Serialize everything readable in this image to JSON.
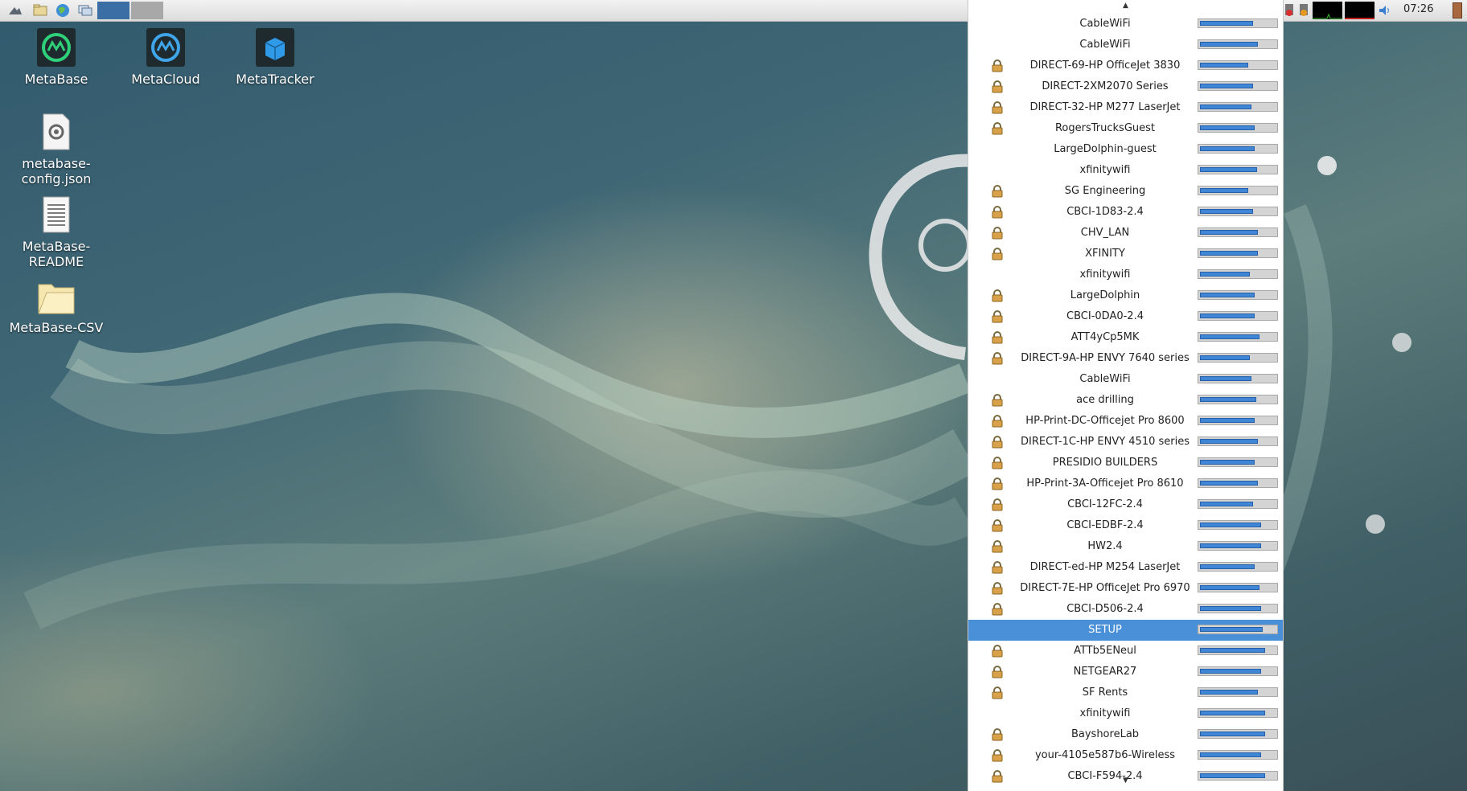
{
  "panel": {
    "clock": "07:26",
    "workspaces": [
      {
        "name": "workspace-1",
        "color": "#3b6ea5"
      },
      {
        "name": "workspace-2",
        "color": "#a8a8a8"
      }
    ],
    "launchers": [
      "menu-icon",
      "file-manager-icon",
      "web-browser-icon",
      "window-list-icon"
    ],
    "tray": [
      "network-error-icon",
      "network-warning-icon",
      "cpu-monitor-icon",
      "memory-monitor-icon",
      "volume-icon",
      "logout-icon"
    ]
  },
  "desktop": {
    "icons": [
      {
        "label": "MetaBase",
        "icon": "metabase-icon"
      },
      {
        "label": "MetaCloud",
        "icon": "metacloud-icon"
      },
      {
        "label": "MetaTracker",
        "icon": "metatracker-icon"
      },
      {
        "label": "metabase-config.json",
        "line1": "metabase-",
        "line2": "config.json",
        "icon": "config-file-icon"
      },
      {
        "label": "MetaBase-README",
        "line1": "MetaBase-",
        "line2": "README",
        "icon": "text-file-icon"
      },
      {
        "label": "MetaBase-CSV",
        "icon": "folder-icon"
      }
    ]
  },
  "wifi_menu": {
    "selected_ssid": "SETUP",
    "networks": [
      {
        "ssid": "CableWiFi",
        "secured": false,
        "signal": 0.7
      },
      {
        "ssid": "CableWiFi",
        "secured": false,
        "signal": 0.77
      },
      {
        "ssid": "DIRECT-69-HP OfficeJet 3830",
        "secured": true,
        "signal": 0.64
      },
      {
        "ssid": "DIRECT-2XM2070 Series",
        "secured": true,
        "signal": 0.7
      },
      {
        "ssid": "DIRECT-32-HP M277 LaserJet",
        "secured": true,
        "signal": 0.68
      },
      {
        "ssid": "RogersTrucksGuest",
        "secured": true,
        "signal": 0.72
      },
      {
        "ssid": "LargeDolphin-guest",
        "secured": false,
        "signal": 0.72
      },
      {
        "ssid": "xfinitywifi",
        "secured": false,
        "signal": 0.76
      },
      {
        "ssid": "SG Engineering",
        "secured": true,
        "signal": 0.64
      },
      {
        "ssid": "CBCI-1D83-2.4",
        "secured": true,
        "signal": 0.7
      },
      {
        "ssid": "CHV_LAN",
        "secured": true,
        "signal": 0.77
      },
      {
        "ssid": "XFINITY",
        "secured": true,
        "signal": 0.77
      },
      {
        "ssid": "xfinitywifi",
        "secured": false,
        "signal": 0.66
      },
      {
        "ssid": "LargeDolphin",
        "secured": true,
        "signal": 0.72
      },
      {
        "ssid": "CBCI-0DA0-2.4",
        "secured": true,
        "signal": 0.72
      },
      {
        "ssid": "ATT4yCp5MK",
        "secured": true,
        "signal": 0.79
      },
      {
        "ssid": "DIRECT-9A-HP ENVY 7640 series",
        "secured": true,
        "signal": 0.66
      },
      {
        "ssid": "CableWiFi",
        "secured": false,
        "signal": 0.68
      },
      {
        "ssid": "ace drilling",
        "secured": true,
        "signal": 0.74
      },
      {
        "ssid": "HP-Print-DC-Officejet Pro 8600",
        "secured": true,
        "signal": 0.72
      },
      {
        "ssid": "DIRECT-1C-HP ENVY 4510 series",
        "secured": true,
        "signal": 0.77
      },
      {
        "ssid": "PRESIDIO BUILDERS",
        "secured": true,
        "signal": 0.72
      },
      {
        "ssid": "HP-Print-3A-Officejet Pro 8610",
        "secured": true,
        "signal": 0.77
      },
      {
        "ssid": "CBCI-12FC-2.4",
        "secured": true,
        "signal": 0.7
      },
      {
        "ssid": "CBCI-EDBF-2.4",
        "secured": true,
        "signal": 0.81
      },
      {
        "ssid": "HW2.4",
        "secured": true,
        "signal": 0.81
      },
      {
        "ssid": "DIRECT-ed-HP M254 LaserJet",
        "secured": true,
        "signal": 0.72
      },
      {
        "ssid": "DIRECT-7E-HP OfficeJet Pro 6970",
        "secured": true,
        "signal": 0.79
      },
      {
        "ssid": "CBCI-D506-2.4",
        "secured": true,
        "signal": 0.81
      },
      {
        "ssid": "SETUP",
        "secured": false,
        "signal": 0.83
      },
      {
        "ssid": "ATTb5ENeul",
        "secured": true,
        "signal": 0.86
      },
      {
        "ssid": "NETGEAR27",
        "secured": true,
        "signal": 0.81
      },
      {
        "ssid": "SF Rents",
        "secured": true,
        "signal": 0.77
      },
      {
        "ssid": "xfinitywifi",
        "secured": false,
        "signal": 0.86
      },
      {
        "ssid": "BayshoreLab",
        "secured": true,
        "signal": 0.86
      },
      {
        "ssid": "your-4105e587b6-Wireless",
        "secured": true,
        "signal": 0.81
      },
      {
        "ssid": "CBCI-F594-2.4",
        "secured": true,
        "signal": 0.86
      }
    ]
  }
}
